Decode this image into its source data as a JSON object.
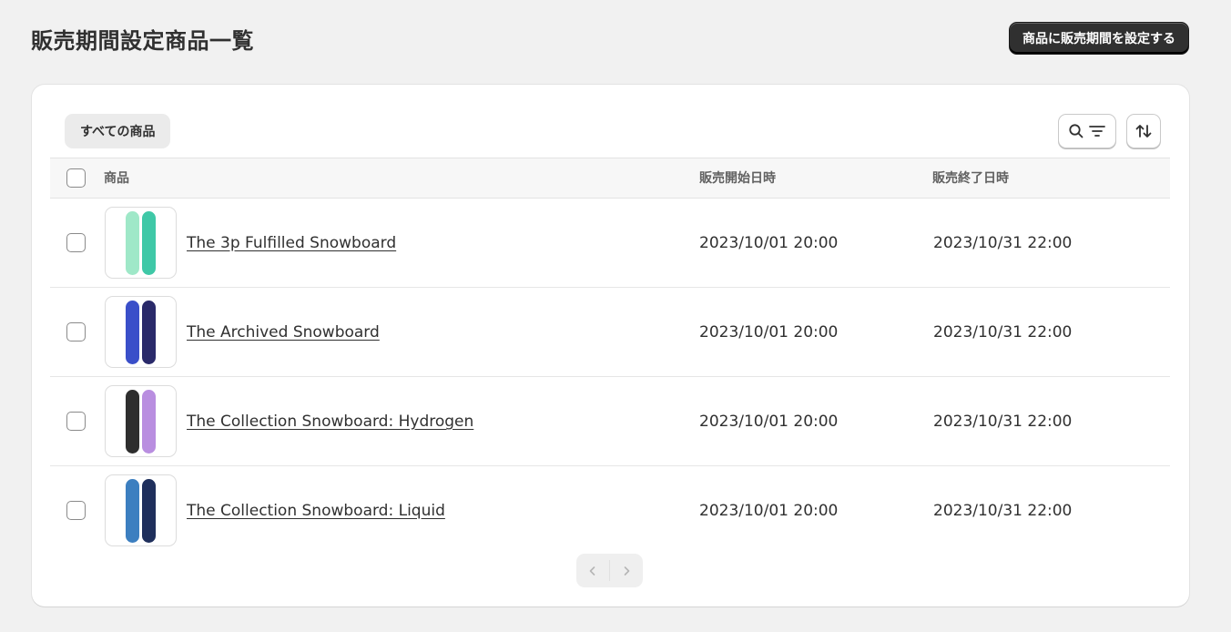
{
  "page": {
    "title": "販売期間設定商品一覧",
    "primary_action": "商品に販売期間を設定する"
  },
  "tabs": [
    {
      "label": "すべての商品",
      "selected": true
    }
  ],
  "toolbar": {
    "search_filter_icon": "search-filter-icon",
    "sort_icon": "sort-arrows-icon"
  },
  "table": {
    "headers": {
      "product": "商品",
      "start": "販売開始日時",
      "end": "販売終了日時"
    },
    "rows": [
      {
        "name": "The 3p Fulfilled Snowboard",
        "start": "2023/10/01 20:00",
        "end": "2023/10/31 22:00",
        "colors": [
          "#9fe8c8",
          "#3fc8a7"
        ]
      },
      {
        "name": "The Archived Snowboard",
        "start": "2023/10/01 20:00",
        "end": "2023/10/31 22:00",
        "colors": [
          "#3a4fc9",
          "#2a2a6a"
        ]
      },
      {
        "name": "The Collection Snowboard: Hydrogen",
        "start": "2023/10/01 20:00",
        "end": "2023/10/31 22:00",
        "colors": [
          "#2e2e2e",
          "#b98ee0"
        ]
      },
      {
        "name": "The Collection Snowboard: Liquid",
        "start": "2023/10/01 20:00",
        "end": "2023/10/31 22:00",
        "colors": [
          "#3c7fc0",
          "#1f2f5c"
        ]
      }
    ]
  },
  "pagination": {
    "prev_icon": "chevron-left-icon",
    "next_icon": "chevron-right-icon"
  }
}
